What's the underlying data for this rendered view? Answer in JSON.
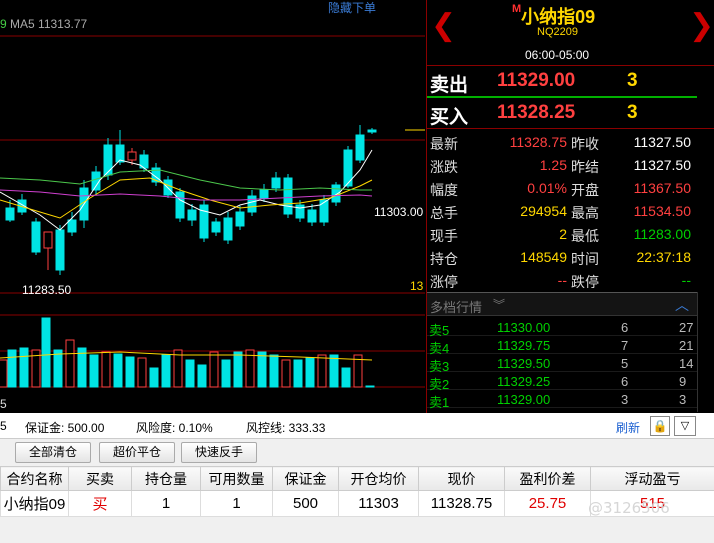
{
  "chart": {
    "ma_label": "MA5 11313.77",
    "ma_prefix": "9",
    "hide_order": "隐藏下单",
    "low_label": "11283.50",
    "price_tag": "11303.00",
    "count_label": "13",
    "volume_axis_label": "5"
  },
  "quote": {
    "title_prefix": "M",
    "title": "小纳指09",
    "code": "NQ2209",
    "session": "06:00-05:00",
    "sell_label": "卖出",
    "sell_price": "11329.00",
    "sell_qty": "3",
    "buy_label": "买入",
    "buy_price": "11328.25",
    "buy_qty": "3"
  },
  "stats": [
    {
      "l1": "最新",
      "v1": "11328.75",
      "c1": "red",
      "l2": "昨收",
      "v2": "11327.50",
      "c2": "white"
    },
    {
      "l1": "涨跌",
      "v1": "1.25",
      "c1": "red",
      "l2": "昨结",
      "v2": "11327.50",
      "c2": "white"
    },
    {
      "l1": "幅度",
      "v1": "0.01%",
      "c1": "red",
      "l2": "开盘",
      "v2": "11367.50",
      "c2": "red"
    },
    {
      "l1": "总手",
      "v1": "294954",
      "c1": "yellow",
      "l2": "最高",
      "v2": "11534.50",
      "c2": "red"
    },
    {
      "l1": "现手",
      "v1": "2",
      "c1": "yellow",
      "l2": "最低",
      "v2": "11283.00",
      "c2": "green"
    },
    {
      "l1": "持仓",
      "v1": "148549",
      "c1": "yellow",
      "l2": "时间",
      "v2": "22:37:18",
      "c2": "yellow"
    },
    {
      "l1": "涨停",
      "v1": "--",
      "c1": "red",
      "l2": "跌停",
      "v2": "--",
      "c2": "green"
    }
  ],
  "depth": {
    "header": "多档行情",
    "asks": [
      {
        "label": "卖5",
        "price": "11330.00",
        "vol": "6",
        "vol2": "27"
      },
      {
        "label": "卖4",
        "price": "11329.75",
        "vol": "7",
        "vol2": "21"
      },
      {
        "label": "卖3",
        "price": "11329.50",
        "vol": "5",
        "vol2": "14"
      },
      {
        "label": "卖2",
        "price": "11329.25",
        "vol": "6",
        "vol2": "9"
      },
      {
        "label": "卖1",
        "price": "11329.00",
        "vol": "3",
        "vol2": "3"
      }
    ]
  },
  "account": {
    "prefix": "5",
    "margin": "保证金: 500.00",
    "risk": "风险度: 0.10%",
    "risk_line": "风控线: 333.33",
    "refresh": "刷新"
  },
  "buttons": {
    "close_all": "全部清仓",
    "super_close": "超价平仓",
    "quick_reverse": "快速反手"
  },
  "positions": {
    "columns": [
      "合约名称",
      "买卖",
      "持仓量",
      "可用数量",
      "保证金",
      "开仓均价",
      "现价",
      "盈利价差",
      "浮动盈亏"
    ],
    "rows": [
      [
        "小纳指09",
        "买",
        "1",
        "1",
        "500",
        "11303",
        "11328.75",
        "25.75",
        "515"
      ]
    ]
  },
  "watermark": "@3126506",
  "colors": {
    "up": "#ff4040",
    "down": "#00e5e5",
    "ma_yellow": "#ffd700",
    "ma_green": "#4cc84c",
    "ma_magenta": "#d040d0",
    "ma_white": "#ffffff"
  }
}
